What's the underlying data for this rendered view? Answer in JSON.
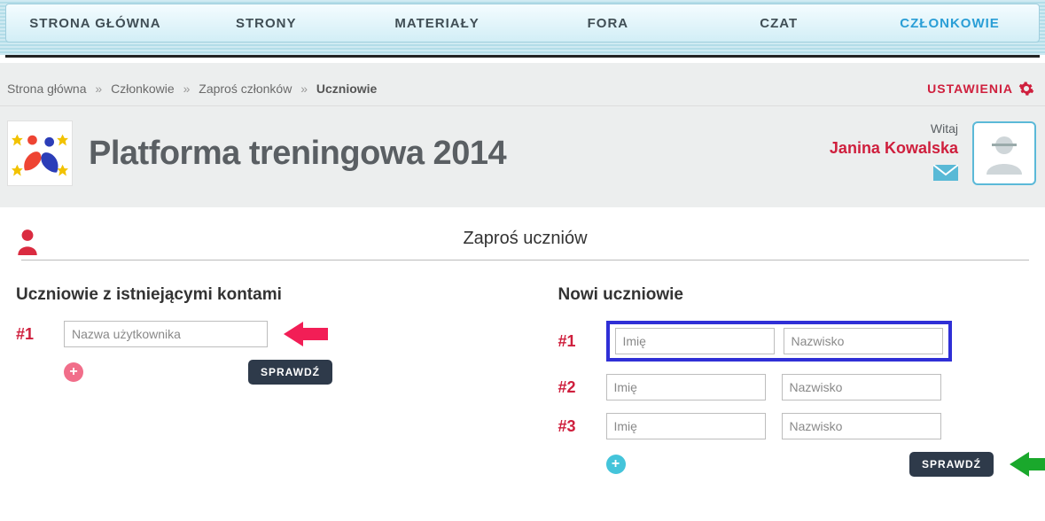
{
  "nav": {
    "items": [
      "STRONA GŁÓWNA",
      "STRONY",
      "MATERIAŁY",
      "FORA",
      "CZAT",
      "CZŁONKOWIE"
    ],
    "active_index": 5
  },
  "breadcrumb": {
    "items": [
      "Strona główna",
      "Członkowie",
      "Zaproś członków",
      "Uczniowie"
    ],
    "current_index": 3
  },
  "settings_label": "USTAWIENIA",
  "page_title": "Platforma treningowa 2014",
  "greeting": "Witaj",
  "user_name": "Janina Kowalska",
  "invite": {
    "title": "Zaproś uczniów",
    "left": {
      "heading": "Uczniowie z istniejącymi kontami",
      "rows": [
        {
          "num": "#1",
          "username_placeholder": "Nazwa użytkownika"
        }
      ],
      "check_label": "SPRAWDŹ"
    },
    "right": {
      "heading": "Nowi uczniowie",
      "rows": [
        {
          "num": "#1",
          "first_placeholder": "Imię",
          "last_placeholder": "Nazwisko"
        },
        {
          "num": "#2",
          "first_placeholder": "Imię",
          "last_placeholder": "Nazwisko"
        },
        {
          "num": "#3",
          "first_placeholder": "Imię",
          "last_placeholder": "Nazwisko"
        }
      ],
      "check_label": "SPRAWDŹ"
    }
  }
}
